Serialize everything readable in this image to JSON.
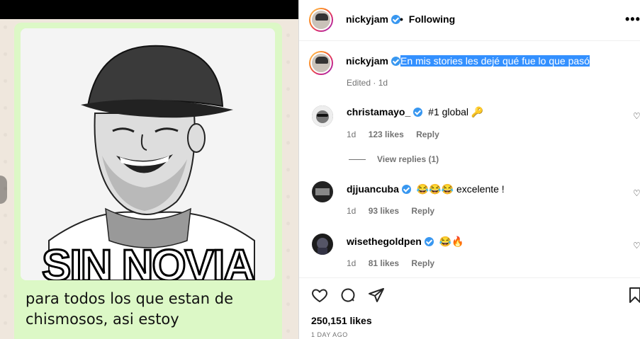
{
  "media": {
    "meme_text": "SIN NOVIA",
    "caption_line1": "para todos los que estan de",
    "caption_line2": "chismosos, asi estoy"
  },
  "header": {
    "username": "nickyjam",
    "separator": "•",
    "follow_label": "Following",
    "more_label": "•••"
  },
  "post_caption": {
    "username": "nickyjam",
    "text": "En mis stories les dejé qué fue lo que pasó",
    "edited": "Edited · 1d"
  },
  "comments": [
    {
      "username": "christamayo_",
      "text": "#1 global 🔑",
      "age": "1d",
      "likes": "123 likes",
      "reply": "Reply"
    },
    {
      "username": "djjuancuba",
      "text": "😂😂😂 excelente !",
      "age": "1d",
      "likes": "93 likes",
      "reply": "Reply"
    },
    {
      "username": "wisethegoldpen",
      "text": "😂🔥",
      "age": "1d",
      "likes": "81 likes",
      "reply": "Reply"
    }
  ],
  "view_replies": "View replies (1)",
  "stats": {
    "likes": "250,151 likes",
    "time_ago": "1 DAY AGO"
  },
  "icons": {
    "like": "heart-icon",
    "comment": "comment-icon",
    "share": "share-icon",
    "save": "bookmark-icon",
    "verified": "verified-badge-icon"
  },
  "colors": {
    "accent": "#3897f0",
    "highlight": "#3390ff",
    "bubble": "#dcf8c6"
  }
}
